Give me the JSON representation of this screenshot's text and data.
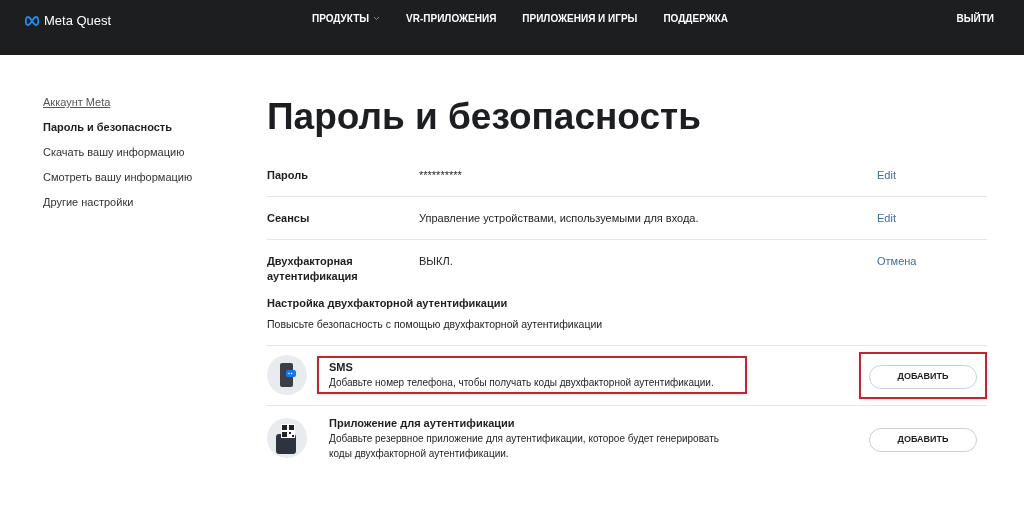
{
  "header": {
    "logo": "Meta Quest",
    "nav": [
      {
        "label": "ПРОДУКТЫ",
        "dropdown": true
      },
      {
        "label": "VR-ПРИЛОЖЕНИЯ",
        "dropdown": false
      },
      {
        "label": "ПРИЛОЖЕНИЯ И ИГРЫ",
        "dropdown": false
      },
      {
        "label": "ПОДДЕРЖКА",
        "dropdown": false
      }
    ],
    "logout": "ВЫЙТИ"
  },
  "sidebar": {
    "items": [
      {
        "label": "Аккаунт Meta",
        "kind": "link",
        "selected": false
      },
      {
        "label": "Пароль и безопасность",
        "kind": "item",
        "selected": true
      },
      {
        "label": "Скачать вашу информацию",
        "kind": "item",
        "selected": false
      },
      {
        "label": "Смотреть вашу информацию",
        "kind": "item",
        "selected": false
      },
      {
        "label": "Другие настройки",
        "kind": "item",
        "selected": false
      }
    ]
  },
  "title": "Пароль и безопасность",
  "settings": [
    {
      "label": "Пароль",
      "value": "**********",
      "action": "Edit"
    },
    {
      "label": "Сеансы",
      "value": "Управление устройствами, используемыми для входа.",
      "action": "Edit"
    },
    {
      "label": "Двухфакторная аутентификация",
      "value": "ВЫКЛ.",
      "action": "Отмена"
    }
  ],
  "setup": {
    "heading": "Настройка двухфакторной аутентификации",
    "description": "Повысьте безопасность с помощью двухфакторной аутентификации",
    "methods": [
      {
        "kind": "sms",
        "title": "SMS",
        "description": "Добавьте номер телефона, чтобы получать коды двухфакторной аутентификации.",
        "button": "ДОБАВИТЬ",
        "highlighted": true
      },
      {
        "kind": "app",
        "title": "Приложение для аутентификации",
        "description": "Добавьте резервное приложение для аутентификации, которое будет генерировать коды двухфакторной аутентификации.",
        "button": "ДОБАВИТЬ",
        "highlighted": false
      }
    ]
  }
}
